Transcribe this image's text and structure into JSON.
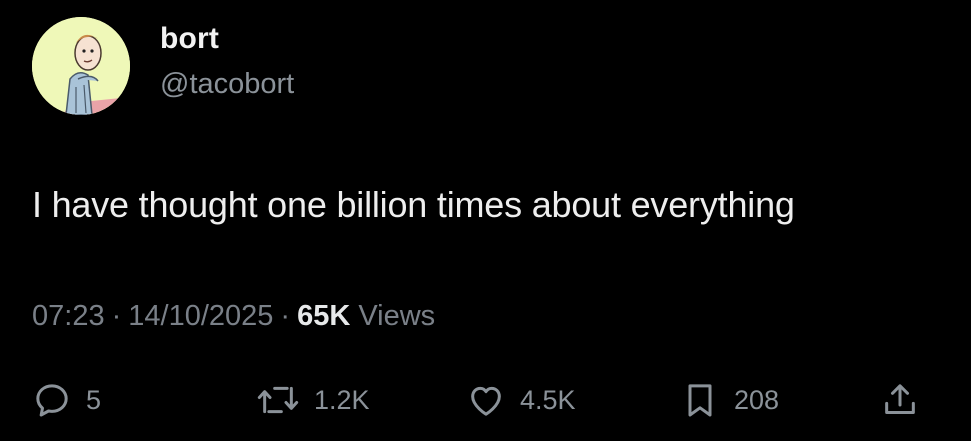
{
  "author": {
    "display_name": "bort",
    "handle": "@tacobort",
    "avatar_icon": "cartoon-character-avatar",
    "avatar_bg": "#eff8b8"
  },
  "tweet": {
    "text": "I have thought one billion times about everything"
  },
  "meta": {
    "time": "07:23",
    "date": "14/10/2025",
    "separator": "·",
    "views_count": "65K",
    "views_label": "Views"
  },
  "actions": {
    "reply": {
      "icon": "reply-bubble-icon",
      "count": "5"
    },
    "retweet": {
      "icon": "retweet-icon",
      "count": "1.2K"
    },
    "like": {
      "icon": "heart-icon",
      "count": "4.5K"
    },
    "bookmark": {
      "icon": "bookmark-icon",
      "count": "208"
    },
    "share": {
      "icon": "share-icon"
    }
  },
  "colors": {
    "background": "#000000",
    "primary_text": "#e7e9ea",
    "secondary_text": "#8b9299"
  }
}
